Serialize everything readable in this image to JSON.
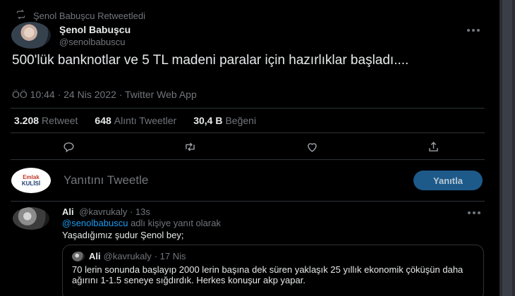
{
  "retweet_banner": {
    "icon": "retweet-icon",
    "text": "Şenol Babuşcu Retweetledi"
  },
  "tweet": {
    "author_name": "Şenol Babuşcu",
    "author_handle": "@senolbabuscu",
    "more_icon": "more-horizontal-icon",
    "text": "500'lük banknotlar ve 5 TL madeni paralar için hazırlıklar başladı....",
    "meta": "ÖÖ 10:44 · 24 Nis 2022 · Twitter Web App",
    "stats": [
      {
        "value": "3.208",
        "label": "Retweet"
      },
      {
        "value": "648",
        "label": "Alıntı Tweetler"
      },
      {
        "value": "30,4 B",
        "label": "Beğeni"
      }
    ],
    "actions": [
      "reply-icon",
      "retweet-icon",
      "like-icon",
      "share-icon"
    ]
  },
  "composer": {
    "avatar_logo_line1": "Emlak",
    "avatar_logo_line2": "KULİSİ",
    "placeholder": "Yanıtını Tweetle",
    "button_label": "Yanıtla"
  },
  "reply": {
    "author_name": "Ali",
    "author_handle": "@kavrukaly",
    "time": "· 13s",
    "replying_link": "@senolbabuscu",
    "replying_suffix": "adlı kişiye yanıt olarak",
    "text": "Yaşadığımız şudur Şenol bey;",
    "quote": {
      "author_name": "Ali",
      "author_handle": "@kavrukaly",
      "time": "· 17 Nis",
      "text": "70 lerin sonunda başlayıp 2000 lerin başına dek süren yaklaşık 25 yıllık ekonomik çöküşün daha ağırını 1-1.5 seneye sığdırdık. Herkes konuşur akp yapar."
    }
  },
  "colors": {
    "background": "#000000",
    "text": "#e7e9ea",
    "muted": "#71767b",
    "link": "#1d9bf0",
    "button": "#1d5a8a"
  }
}
